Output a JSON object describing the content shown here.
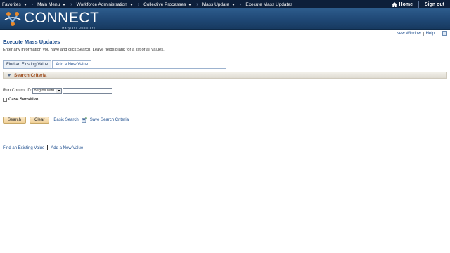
{
  "nav": {
    "items": [
      {
        "label": "Favorites",
        "dropdown": true
      },
      {
        "label": "Main Menu",
        "dropdown": true
      },
      {
        "label": "Workforce Administration",
        "dropdown": true
      },
      {
        "label": "Collective Processes",
        "dropdown": true
      },
      {
        "label": "Mass Update",
        "dropdown": true
      },
      {
        "label": "Execute Mass Updates",
        "dropdown": false
      }
    ],
    "home_label": "Home",
    "signout_label": "Sign out"
  },
  "banner": {
    "logo_text": "CONNECT",
    "logo_subtext": "Maryland Judiciary"
  },
  "utility": {
    "new_window": "New Window",
    "help": "Help"
  },
  "page": {
    "title": "Execute Mass Updates",
    "instructions": "Enter any information you have and click Search. Leave fields blank for a list of all values."
  },
  "tabs": [
    {
      "label": "Find an Existing Value",
      "active": true
    },
    {
      "label": "Add a New Value",
      "active": false
    }
  ],
  "search_criteria": {
    "header": "Search Criteria",
    "field_label": "Run Control ID:",
    "operator": "begins with",
    "value": "",
    "case_sensitive_label": "Case Sensitive"
  },
  "actions": {
    "search": "Search",
    "clear": "Clear",
    "basic_search": "Basic Search",
    "save_search": "Save Search Criteria"
  },
  "bottom_links": {
    "find": "Find an Existing Value",
    "add": "Add a New Value"
  },
  "colors": {
    "nav_bg": "#0d1f3a",
    "banner_bg": "#1e4673",
    "link": "#1f4f8f",
    "section_label": "#9c4a1a",
    "button_bg": "#f0cf95"
  }
}
